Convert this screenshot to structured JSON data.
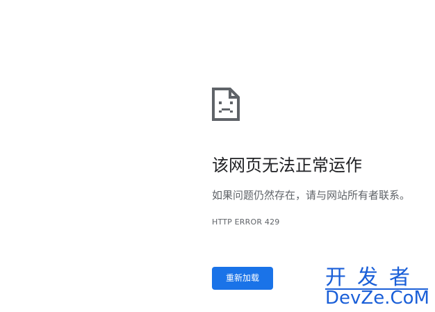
{
  "error_page": {
    "icon": "sad-page-icon",
    "title": "该网页无法正常运作",
    "message": "如果问题仍然存在，请与网站所有者联系。",
    "error_code": "HTTP ERROR 429",
    "reload_label": "重新加载"
  },
  "watermark": {
    "line1": "开发者",
    "line2": "DevZe.CoM"
  },
  "colors": {
    "accent": "#1a73e8",
    "title_text": "#202124",
    "secondary_text": "#5f6368",
    "watermark": "#1a5fd8"
  }
}
